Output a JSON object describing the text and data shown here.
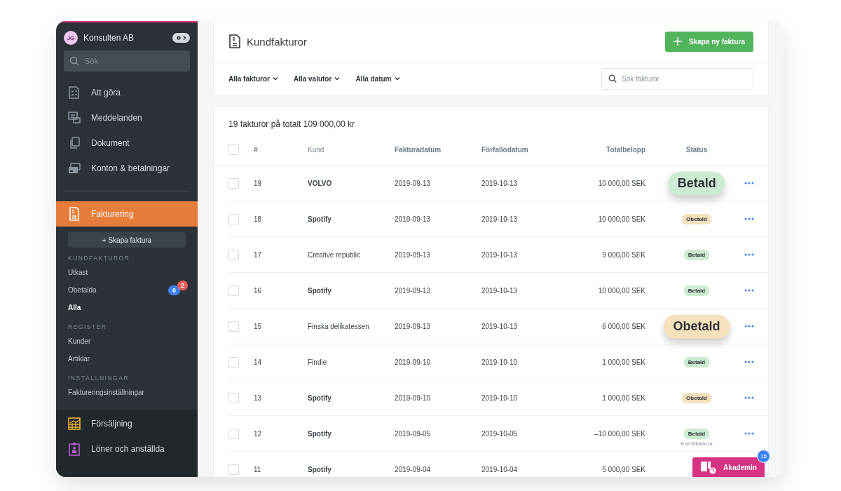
{
  "sidebar": {
    "company": {
      "initials": "JG",
      "name": "Konsulten AB"
    },
    "search": {
      "placeholder": "Sök"
    },
    "nav": [
      {
        "label": "Att göra",
        "selected": false
      },
      {
        "label": "Meddelanden",
        "selected": false
      },
      {
        "label": "Dokument",
        "selected": false
      },
      {
        "label": "Konton & betalningar",
        "selected": false
      },
      {
        "label": "Fakturering",
        "selected": true
      }
    ],
    "create_button": "+ Skapa faktura",
    "groups": [
      {
        "heading": "KUNDFAKTUROR",
        "items": [
          {
            "label": "Utkast",
            "selected": false
          },
          {
            "label": "Obetalda",
            "selected": false,
            "badges": [
              {
                "count": "6",
                "color": "#3b82f6"
              },
              {
                "count": "2",
                "color": "#ef5b5b"
              }
            ]
          },
          {
            "label": "Alla",
            "selected": true
          }
        ]
      },
      {
        "heading": "REGISTER",
        "items": [
          {
            "label": "Kunder",
            "selected": false
          },
          {
            "label": "Artiklar",
            "selected": false
          }
        ]
      },
      {
        "heading": "INSTÄLLNINGAR",
        "items": [
          {
            "label": "Faktureringsinställningar",
            "selected": false
          }
        ]
      }
    ],
    "bottom_nav": [
      {
        "label": "Försäljning"
      },
      {
        "label": "Löner och anställda"
      }
    ]
  },
  "header": {
    "title": "Kundfakturor",
    "new_button": "Skapa ny faktura",
    "filters": [
      "Alla fakturor",
      "Alla valutor",
      "Alla datum"
    ],
    "search": {
      "placeholder": "Sök fakturor"
    }
  },
  "table": {
    "all_selected": false,
    "summary": "19 fakturor på totalt 109 000,00 kr",
    "columns": [
      "#",
      "Kund",
      "Fakturadatum",
      "Förfallodatum",
      "Totalbelopp",
      "Status"
    ],
    "rows": [
      {
        "number": "19",
        "customer": "VOLVO",
        "bold": true,
        "invoice_date": "2019-09-13",
        "due_date": "2019-10-13",
        "total": "10 000,00 SEK",
        "status": {
          "label": "Betald",
          "kind": "paid",
          "enlarged": true
        },
        "checked": false
      },
      {
        "number": "18",
        "customer": "Spotify",
        "bold": true,
        "invoice_date": "2019-09-13",
        "due_date": "2019-10-13",
        "total": "10 000,00 SEK",
        "status": {
          "label": "Obetald",
          "kind": "unpaid",
          "enlarged": false
        },
        "checked": false
      },
      {
        "number": "17",
        "customer": "Creative republic",
        "bold": false,
        "invoice_date": "2019-09-13",
        "due_date": "2019-10-13",
        "total": "9 000,00 SEK",
        "status": {
          "label": "Betald",
          "kind": "paid",
          "enlarged": false
        },
        "checked": false
      },
      {
        "number": "16",
        "customer": "Spotify",
        "bold": true,
        "invoice_date": "2019-09-13",
        "due_date": "2019-10-13",
        "total": "10 000,00 SEK",
        "status": {
          "label": "Betald",
          "kind": "paid",
          "enlarged": false
        },
        "checked": false
      },
      {
        "number": "15",
        "customer": "Finska delikatessen",
        "bold": false,
        "invoice_date": "2019-09-13",
        "due_date": "2019-10-13",
        "total": "6 000,00 SEK",
        "status": {
          "label": "Obetald",
          "kind": "unpaid",
          "enlarged": true
        },
        "checked": false
      },
      {
        "number": "14",
        "customer": "Findie",
        "bold": false,
        "invoice_date": "2019-09-10",
        "due_date": "2019-10-10",
        "total": "1 000,00 SEK",
        "status": {
          "label": "Betald",
          "kind": "paid",
          "enlarged": false
        },
        "checked": false
      },
      {
        "number": "13",
        "customer": "Spotify",
        "bold": true,
        "invoice_date": "2019-09-10",
        "due_date": "2019-10-10",
        "total": "1 000,00 SEK",
        "status": {
          "label": "Obetald",
          "kind": "unpaid",
          "enlarged": false
        },
        "checked": false
      },
      {
        "number": "12",
        "customer": "Spotify",
        "bold": true,
        "invoice_date": "2019-09-05",
        "due_date": "2019-10-05",
        "total": "–10 000,00 SEK",
        "status": {
          "label": "Betald",
          "kind": "paid",
          "enlarged": false,
          "note": "Kreditfaktura"
        },
        "checked": false
      },
      {
        "number": "11",
        "customer": "Spotify",
        "bold": true,
        "invoice_date": "2019-09-04",
        "due_date": "2019-10-04",
        "total": "5 000,00 SEK",
        "checked": false
      }
    ]
  },
  "help_button": {
    "label": "Akademin",
    "badge": "15"
  }
}
